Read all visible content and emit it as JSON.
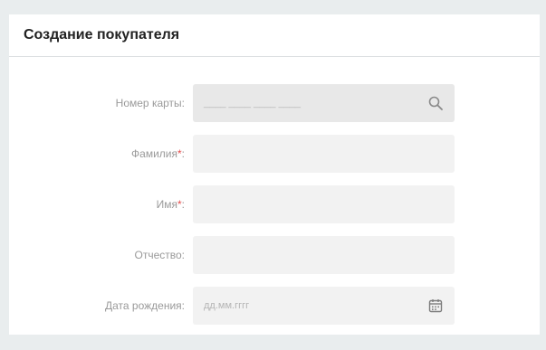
{
  "title": "Создание покупателя",
  "fields": [
    {
      "label": "Номер карты:",
      "placeholder": "____ ____ ____ ____",
      "required": false,
      "icon": "search-icon"
    },
    {
      "label": "Фамилия",
      "suffix": ":",
      "required": true,
      "placeholder": ""
    },
    {
      "label": "Имя",
      "suffix": ":",
      "required": true,
      "placeholder": ""
    },
    {
      "label": "Отчество:",
      "required": false,
      "placeholder": ""
    },
    {
      "label": "Дата рождения:",
      "placeholder": "дд.мм.гггг",
      "required": false,
      "icon": "calendar-icon"
    }
  ],
  "required_mark": "*",
  "colors": {
    "background": "#e9edee",
    "card": "#ffffff",
    "input": "#f2f2f2",
    "label": "#9a9a9a",
    "required": "#e54d4d"
  }
}
